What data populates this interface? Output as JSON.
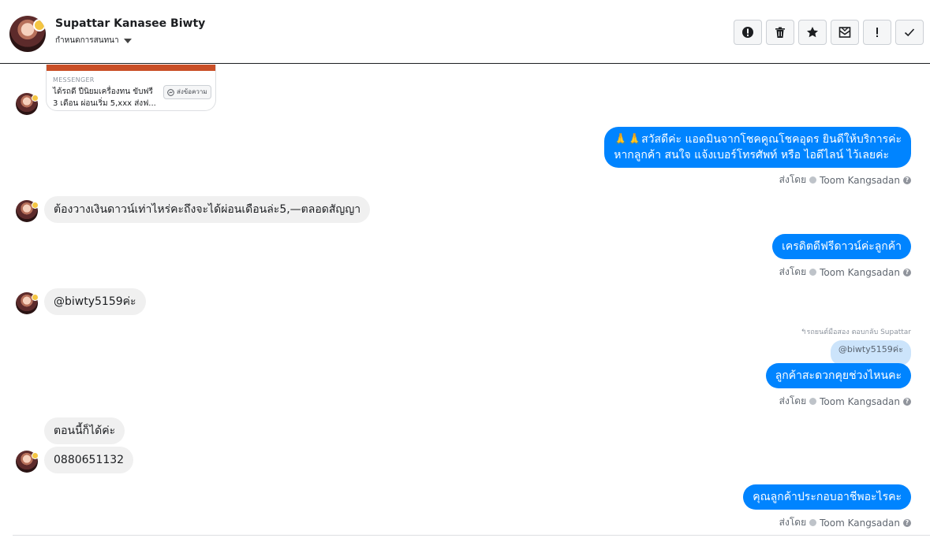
{
  "header": {
    "contact_name": "Supattar Kanasee Biwty",
    "subtitle": "กำหนดการสนทนา"
  },
  "actions": [
    {
      "name": "report-button",
      "icon": "alert-circle-icon"
    },
    {
      "name": "delete-button",
      "icon": "trash-icon"
    },
    {
      "name": "star-button",
      "icon": "star-icon"
    },
    {
      "name": "mark-unread-button",
      "icon": "envelope-icon"
    },
    {
      "name": "important-button",
      "icon": "exclamation-icon"
    },
    {
      "name": "done-button",
      "icon": "check-icon"
    }
  ],
  "card": {
    "label": "MESSENGER",
    "line1": "ได้รถดี ปีนิยมเครื่องทน ขับฟรี",
    "line2": "3 เดือน ผ่อนเริ่ม 5,xxx  ส่งฟ...",
    "button": "ส่งข้อความ"
  },
  "messages": {
    "m1_line1": "🙏🙏สวัสดีค่ะ แอดมินจากโชคคูณโชคอุดร ยินดีให้บริการค่ะ",
    "m1_line2": "หากลูกค้า สนใจ แจ้งเบอร์โทรศัพท์ หรือ ไอดีไลน์  ไว้เลยค่ะ",
    "m2": "ต้องวางเงินดาวน์เท่าไหร่คะถึงจะได้ผ่อนเดือนล่ะ5,—ตลอดสัญญา",
    "m3": "เครดิตดีฟรีดาวน์ค่ะลูกค้า",
    "m4": "@biwty5159ค่ะ",
    "reply_meta": "↰รถยนต์มือสอง ตอบกลับ Supattar",
    "reply_quote": "@biwty5159ค่ะ",
    "m5": "ลูกค้าสะดวกคุยช่วงไหนคะ",
    "m6": "ตอนนี้ก็ได้ค่ะ",
    "m7": "0880651132",
    "m8": "คุณลูกค้าประกอบอาชีพอะไรคะ"
  },
  "sent_by": {
    "prefix": "ส่งโดย",
    "agent": "Toom Kangsadan"
  }
}
